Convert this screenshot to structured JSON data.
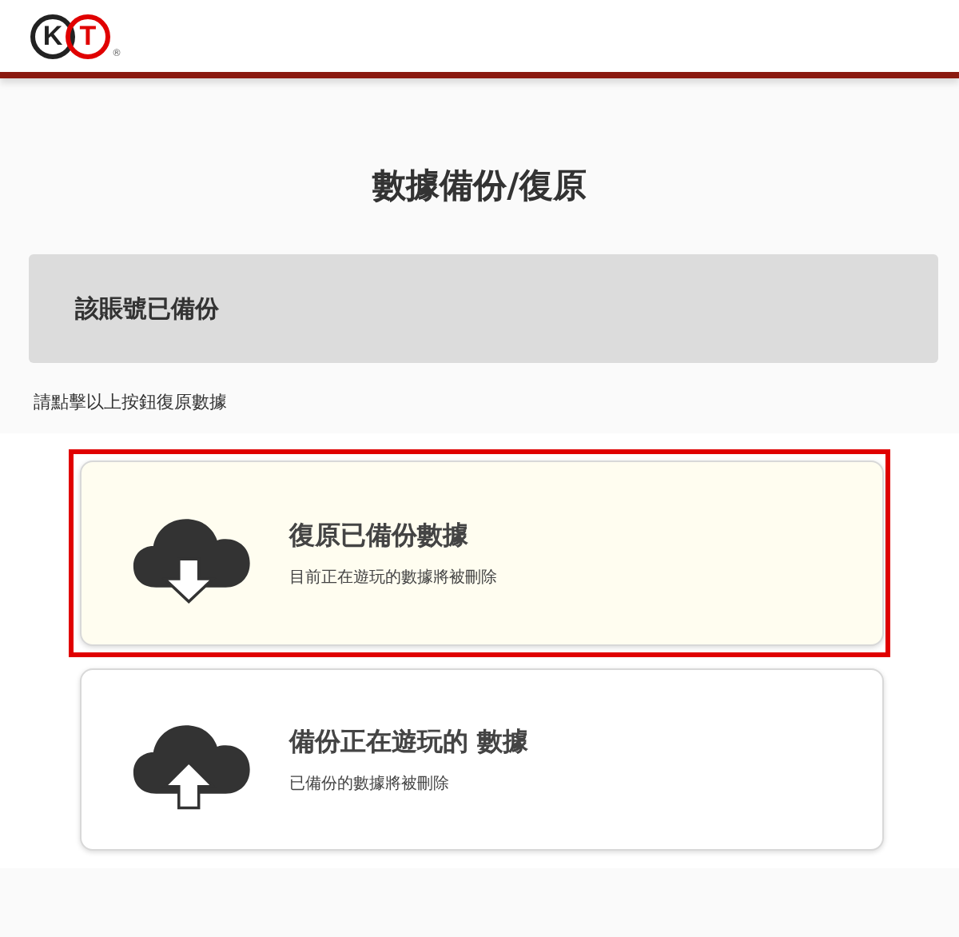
{
  "logo": {
    "letters": [
      "K",
      "T"
    ],
    "mark": "®"
  },
  "page_title": "數據備份/復原",
  "status_box": {
    "text": "該賬號已備份"
  },
  "instruction": "請點擊以上按鈕復原數據",
  "options": [
    {
      "kind": "download",
      "title": "復原已備份數據",
      "subtitle": "目前正在遊玩的數據將被刪除",
      "selected": true,
      "highlighted": true
    },
    {
      "kind": "upload",
      "title": "備份正在遊玩的 數據",
      "subtitle": "已備份的數據將被刪除",
      "selected": false,
      "highlighted": false
    }
  ]
}
